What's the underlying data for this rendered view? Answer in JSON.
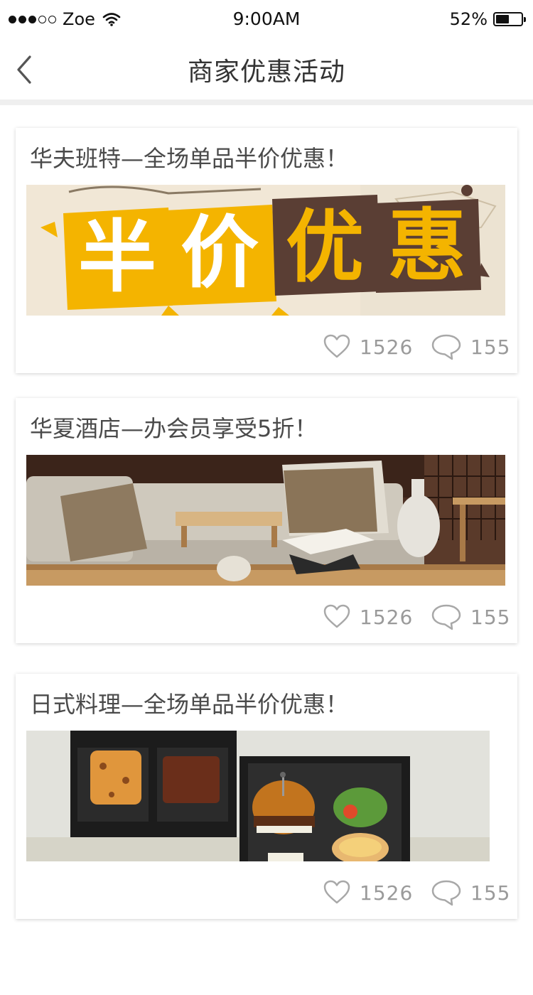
{
  "status_bar": {
    "carrier": "Zoe",
    "signal_filled": 3,
    "signal_total": 5,
    "time": "9:00AM",
    "battery_percent": "52%",
    "battery_level": 0.52
  },
  "nav": {
    "title": "商家优惠活动",
    "back_icon": "chevron-left-icon"
  },
  "colors": {
    "banner_yellow": "#f4b400",
    "banner_brown": "#5a3e34",
    "stat_gray": "#9a9a9a"
  },
  "promotions": [
    {
      "title": "华夫班特—全场单品半价优惠！",
      "banner_text": [
        "半",
        "价",
        "优",
        "惠"
      ],
      "likes": "1526",
      "comments": "155"
    },
    {
      "title": "华夏酒店—办会员享受5折！",
      "likes": "1526",
      "comments": "155"
    },
    {
      "title": "日式料理—全场单品半价优惠！",
      "likes": "1526",
      "comments": "155"
    }
  ]
}
